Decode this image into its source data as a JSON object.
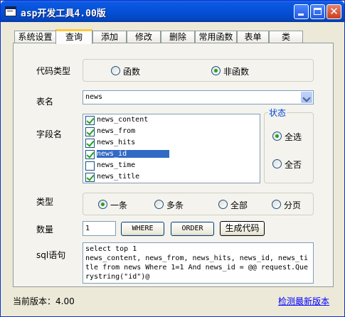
{
  "window": {
    "title": "asp开发工具4.00版"
  },
  "tabs": [
    "系统设置",
    "查询",
    "添加",
    "修改",
    "删除",
    "常用函数",
    "表单",
    "类"
  ],
  "code_type": {
    "label": "代码类型",
    "options": [
      "函数",
      "非函数"
    ],
    "selected": "非函数"
  },
  "table": {
    "label": "表名",
    "value": "news"
  },
  "fields": {
    "label": "字段名",
    "items": [
      {
        "name": "news_content",
        "checked": true
      },
      {
        "name": "news_from",
        "checked": true
      },
      {
        "name": "news_hits",
        "checked": true
      },
      {
        "name": "news_id",
        "checked": true,
        "selected": true
      },
      {
        "name": "news_time",
        "checked": false
      },
      {
        "name": "news_title",
        "checked": true
      }
    ]
  },
  "status": {
    "label": "状态",
    "options": [
      "全选",
      "全否"
    ],
    "selected": "全选"
  },
  "kind": {
    "label": "类型",
    "options": [
      "一条",
      "多条",
      "全部",
      "分页"
    ],
    "selected": "一条"
  },
  "quantity": {
    "label": "数量",
    "value": "1"
  },
  "buttons": {
    "where": "WHERE",
    "order": "ORDER",
    "generate": "生成代码"
  },
  "sql": {
    "label": "sql语句",
    "value": "select top 1\nnews_content, news_from, news_hits, news_id, news_title from news Where 1=1 And news_id = @@ request.Querystring(\"id\")@"
  },
  "footer": {
    "version": "当前版本：4.00",
    "check_update": "检测最新版本"
  }
}
